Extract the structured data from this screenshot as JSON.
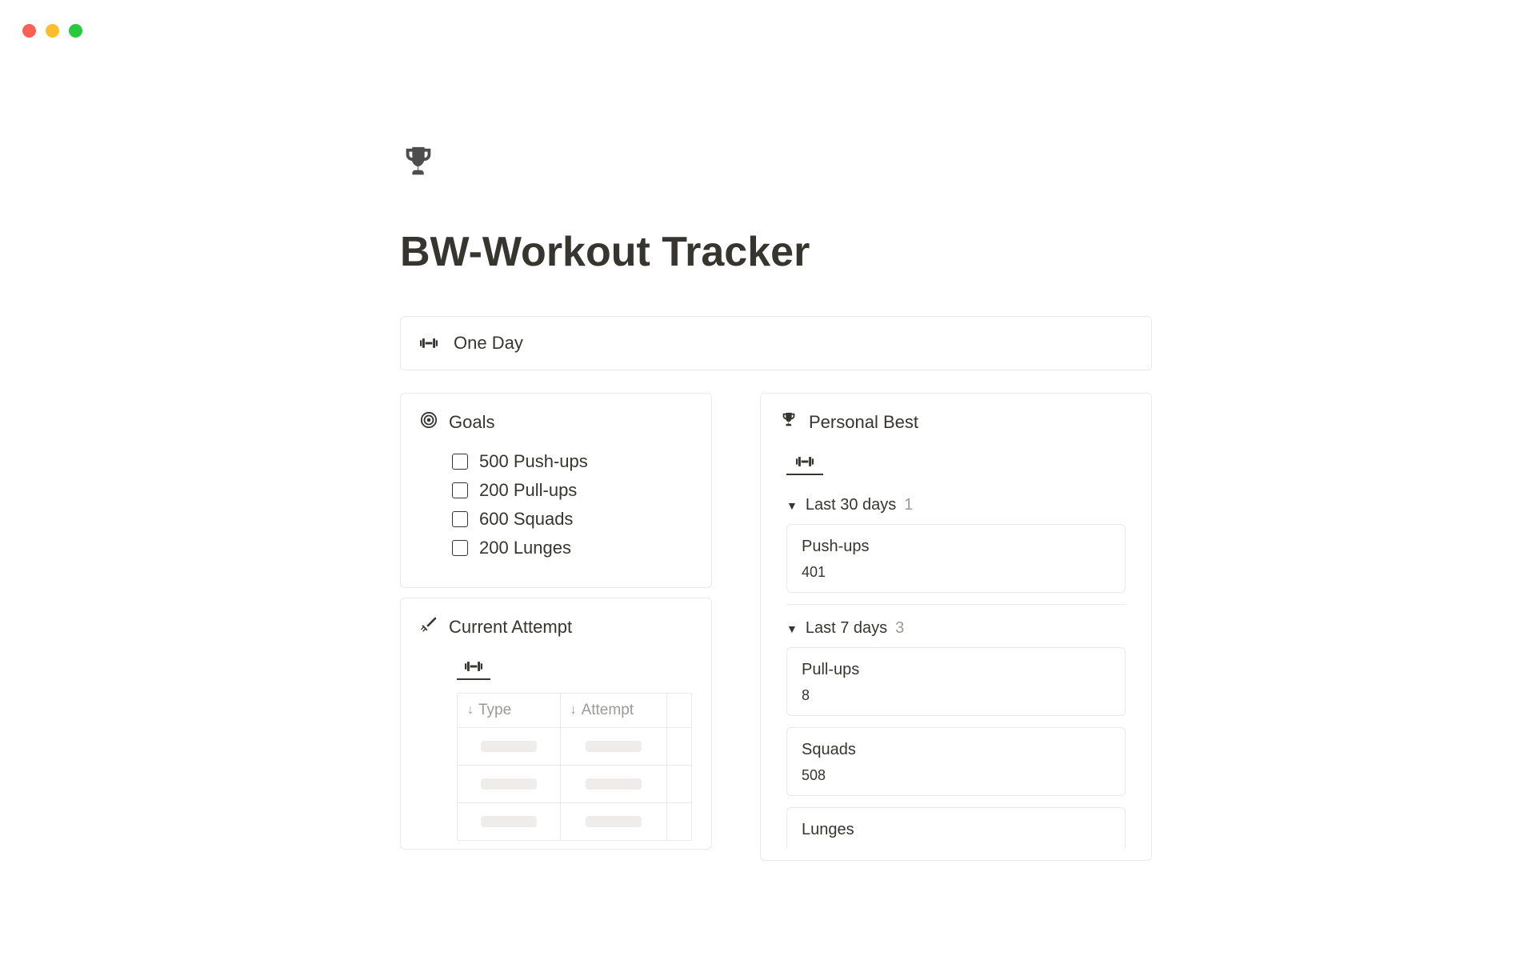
{
  "page_title": "BW-Workout Tracker",
  "callout": {
    "label": "One Day"
  },
  "goals": {
    "heading": "Goals",
    "items": [
      "500 Push-ups",
      "200 Pull-ups",
      "600 Squads",
      "200 Lunges"
    ]
  },
  "current_attempt": {
    "heading": "Current Attempt",
    "columns": {
      "c1": "Type",
      "c2": "Attempt"
    }
  },
  "personal_best": {
    "heading": "Personal Best",
    "groups": [
      {
        "name": "Last 30 days",
        "count": "1",
        "entries": [
          {
            "name": "Push-ups",
            "value": "401"
          }
        ]
      },
      {
        "name": "Last 7 days",
        "count": "3",
        "entries": [
          {
            "name": "Pull-ups",
            "value": "8"
          },
          {
            "name": "Squads",
            "value": "508"
          },
          {
            "name": "Lunges",
            "value": ""
          }
        ]
      }
    ]
  }
}
